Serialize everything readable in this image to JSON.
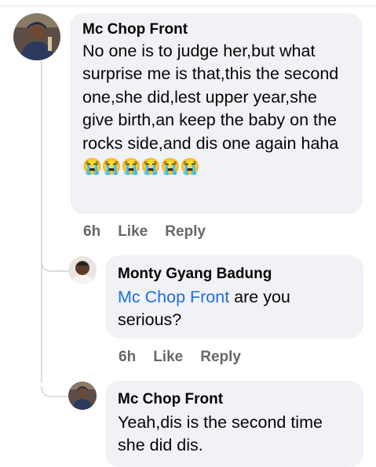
{
  "comments": [
    {
      "author": "Mc Chop Front",
      "text": "No one is to  judge her,but what surprise me is that,this the second one,she did,lest upper year,she give birth,an keep the baby on the rocks side,and dis one again haha",
      "emoji": "😭😭😭😭😭😭",
      "time": "6h",
      "like": "Like",
      "reply": "Reply"
    },
    {
      "author": "Monty Gyang Badung",
      "mention": "Mc Chop Front",
      "text": " are you serious?",
      "time": "6h",
      "like": "Like",
      "reply": "Reply"
    },
    {
      "author": "Mc Chop Front",
      "text": "Yeah,dis is the second time she did dis."
    }
  ]
}
